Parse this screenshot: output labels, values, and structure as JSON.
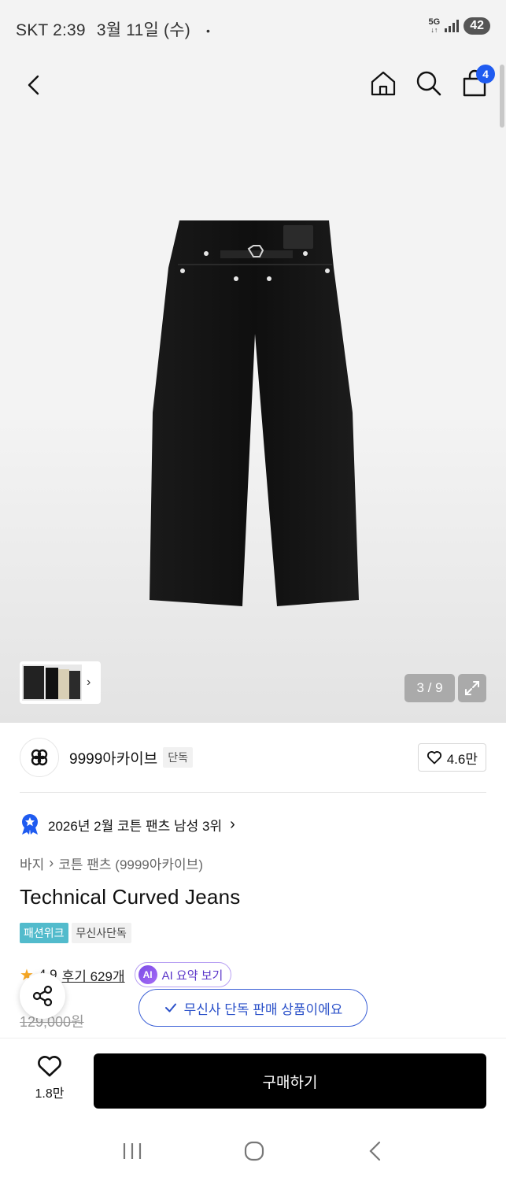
{
  "status_bar": {
    "carrier_time": "SKT 2:39",
    "date": "3월 11일 (수)",
    "dot": "•",
    "network": "5G",
    "battery": "42"
  },
  "header": {
    "cart_count": "4"
  },
  "gallery": {
    "counter": "3 / 9"
  },
  "brand": {
    "name": "9999아카이브",
    "exclusive_tag": "단독",
    "likes": "4.6만"
  },
  "ranking": {
    "text": "2026년 2월 코튼 팬츠 남성 3위"
  },
  "breadcrumb": {
    "category": "바지",
    "subcategory": "코튼 팬츠 (9999아카이브)"
  },
  "product": {
    "title": "Technical Curved Jeans",
    "tags": [
      "패션위크",
      "무신사단독"
    ],
    "rating": "4.9",
    "reviews": "후기 629개",
    "ai_summary": "AI 요약 보기",
    "ai_badge": "AI",
    "original_price": "129,000원"
  },
  "toast": {
    "text": "무신사 단독 판매 상품이에요"
  },
  "bottom_bar": {
    "wish_count": "1.8만",
    "buy_label": "구매하기"
  },
  "colors": {
    "accent_blue": "#1f5bf0",
    "teal_tag": "#52bbcc",
    "ai_purple": "#7b4be6",
    "buy_button": "#000000"
  }
}
